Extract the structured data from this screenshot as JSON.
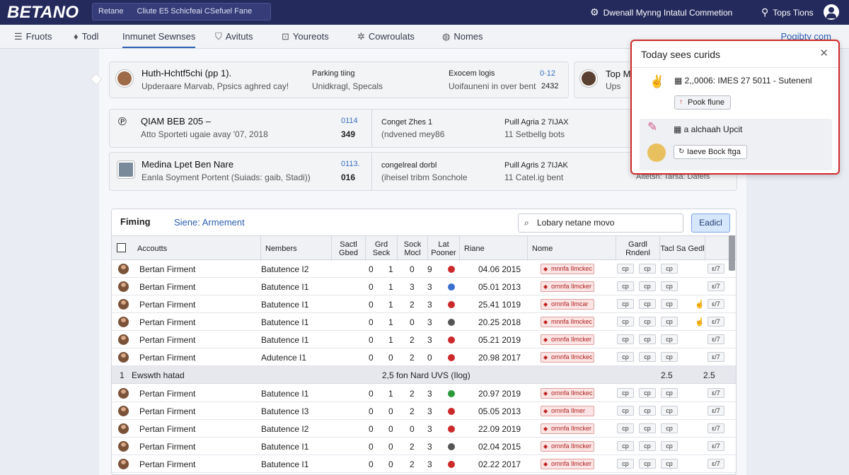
{
  "topbar": {
    "logo": "BETANO",
    "search_left": "Retane",
    "search_right": "Cliute E5 Schicfeai CSefuel Fane",
    "connection": "Dwenall Mynng Intatul Commetion",
    "tips": "Tops Tions"
  },
  "nav": {
    "items": [
      {
        "label": "Fruots",
        "icon": "grid-icon"
      },
      {
        "label": "Todl",
        "icon": "bell-icon"
      },
      {
        "label": "Inmunet Sewnses",
        "icon": "",
        "active": true
      },
      {
        "label": "Avituts",
        "icon": "shield-icon"
      },
      {
        "label": "Youreots",
        "icon": "gift-icon"
      },
      {
        "label": "Cowroulats",
        "icon": "gear-icon"
      },
      {
        "label": "Nomes",
        "icon": "globe-icon"
      }
    ],
    "right_link": "Pogibty com"
  },
  "cards": [
    {
      "title": "Huth-Hchtf5chi (pp 1).",
      "sub": "Upderaare Marvab, Ppsics aghred cay!",
      "mid_title": "Parking tiing",
      "mid_sub": "Unidkragl, Specals",
      "r_title": "Exocem logis",
      "r_sub": "Uoifauneni in over bent",
      "r_blue": "0·12",
      "r_num": "2432"
    },
    {
      "title": "QIAM BEB 205 –",
      "sub": "Atto Sporteti ugaie avay '07, 2018",
      "blue": "0114",
      "num": "349",
      "mid_title": "Conget Zhes 1",
      "mid_sub": "(ndvened mey86",
      "r_title": "Puill Agria 2 7IJAX",
      "r_sub": "11 Setbellg bots"
    },
    {
      "title": "Medina Lpet Ben Nare",
      "sub": "Eanla Soyment Portent (Suiads: gaib, Stadi))",
      "blue": "0113.",
      "num": "016",
      "mid_title": "congelreal dorbl",
      "mid_sub": "(iheisel tribm Sonchole",
      "r_title": "Puill Agris 2 7IJAK",
      "r_sub": "11 Catel.ig bent"
    }
  ],
  "peek_card": {
    "title": "Top M",
    "sub": "Ups",
    "right_text": "Aitetsn: Tarsa: Dafefs"
  },
  "table": {
    "title": "Fiming",
    "subtitle": "Siene: Armement",
    "search_placeholder": "Lobary netane movo",
    "button_label": "Eadicl",
    "headers": [
      "Accoutts",
      "Nembers",
      "Sactl Gbed",
      "Grd Seck",
      "Sock Mocl",
      "Lat Pooner",
      "Riane",
      "Nome",
      "Gardl Rndenl",
      "Tacl Sa Gedl"
    ],
    "rows": [
      {
        "name": "Bertan Firment",
        "member": "Batutence I2",
        "a": "0",
        "b": "1",
        "c": "0",
        "d": "9",
        "dot": "#cc2a2a",
        "date": "04.06 2015",
        "tag": "mnnfa Ilmckec",
        "hand": ""
      },
      {
        "name": "Bertan Firment",
        "member": "Batutence I1",
        "a": "0",
        "b": "1",
        "c": "3",
        "d": "3",
        "dot": "#3a70d0",
        "date": "05.01 2013",
        "tag": "ornnfa Ilmcker",
        "hand": ""
      },
      {
        "name": "Pertan Firment",
        "member": "Batutence I1",
        "a": "0",
        "b": "1",
        "c": "2",
        "d": "3",
        "dot": "#cc2a2a",
        "date": "25.41 1019",
        "tag": "ornnfa Ilmcar",
        "hand": "☝"
      },
      {
        "name": "Pertan Firment",
        "member": "Batutence I1",
        "a": "0",
        "b": "1",
        "c": "0",
        "d": "3",
        "dot": "#555555",
        "date": "20.25 2018",
        "tag": "mnnfa Ilmckec",
        "hand": "☝"
      },
      {
        "name": "Pertan Firment",
        "member": "Batutence I1",
        "a": "0",
        "b": "1",
        "c": "2",
        "d": "3",
        "dot": "#cc2a2a",
        "date": "05.21 2019",
        "tag": "ornnfa Ilmcker",
        "hand": ""
      },
      {
        "name": "Pertan Firment",
        "member": "Adutence I1",
        "a": "0",
        "b": "0",
        "c": "2",
        "d": "0",
        "dot": "#cc2a2a",
        "date": "20.98 2017",
        "tag": "ornnfa Ilmckec",
        "hand": ""
      }
    ],
    "group": {
      "label": "Ewswth hatad",
      "index": "1",
      "mid": "2,5 fon Nard UVS (Ilog)",
      "v1": "2.5",
      "v2": "2.5"
    },
    "rows2": [
      {
        "name": "Pertan Firment",
        "member": "Batutence I1",
        "a": "0",
        "b": "1",
        "c": "2",
        "d": "3",
        "dot": "#2a9a3a",
        "date": "20.97 2019",
        "tag": "ornnfa Ilmckec",
        "hand": ""
      },
      {
        "name": "Pertan Firment",
        "member": "Batutence I3",
        "a": "0",
        "b": "0",
        "c": "2",
        "d": "3",
        "dot": "#cc2a2a",
        "date": "05.05 2013",
        "tag": "ornnfa Ilmer",
        "hand": ""
      },
      {
        "name": "Pertan Firment",
        "member": "Batutence I2",
        "a": "0",
        "b": "0",
        "c": "0",
        "d": "3",
        "dot": "#cc2a2a",
        "date": "22.09 2019",
        "tag": "ornnfa Ilmcker",
        "hand": ""
      },
      {
        "name": "Pertan Firment",
        "member": "Batutence I1",
        "a": "0",
        "b": "0",
        "c": "2",
        "d": "3",
        "dot": "#555555",
        "date": "02.04 2015",
        "tag": "ornnfa Ilmcker",
        "hand": ""
      },
      {
        "name": "Pertan Firment",
        "member": "Batutence I1",
        "a": "0",
        "b": "0",
        "c": "2",
        "d": "3",
        "dot": "#cc2a2a",
        "date": "02.22 2017",
        "tag": "ornnfa Ilmcker",
        "hand": ""
      }
    ],
    "mini_btn": "cp",
    "mini_btn2": "ε/7"
  },
  "notification": {
    "title": "Today sees curids",
    "item1_text": "2,,0006: IMES 27 5011 - Sutenenl",
    "item1_button": "Pook flune",
    "item2_text": "a alchaah Upcit",
    "item2_button": "Iaeve Bock ftga"
  }
}
